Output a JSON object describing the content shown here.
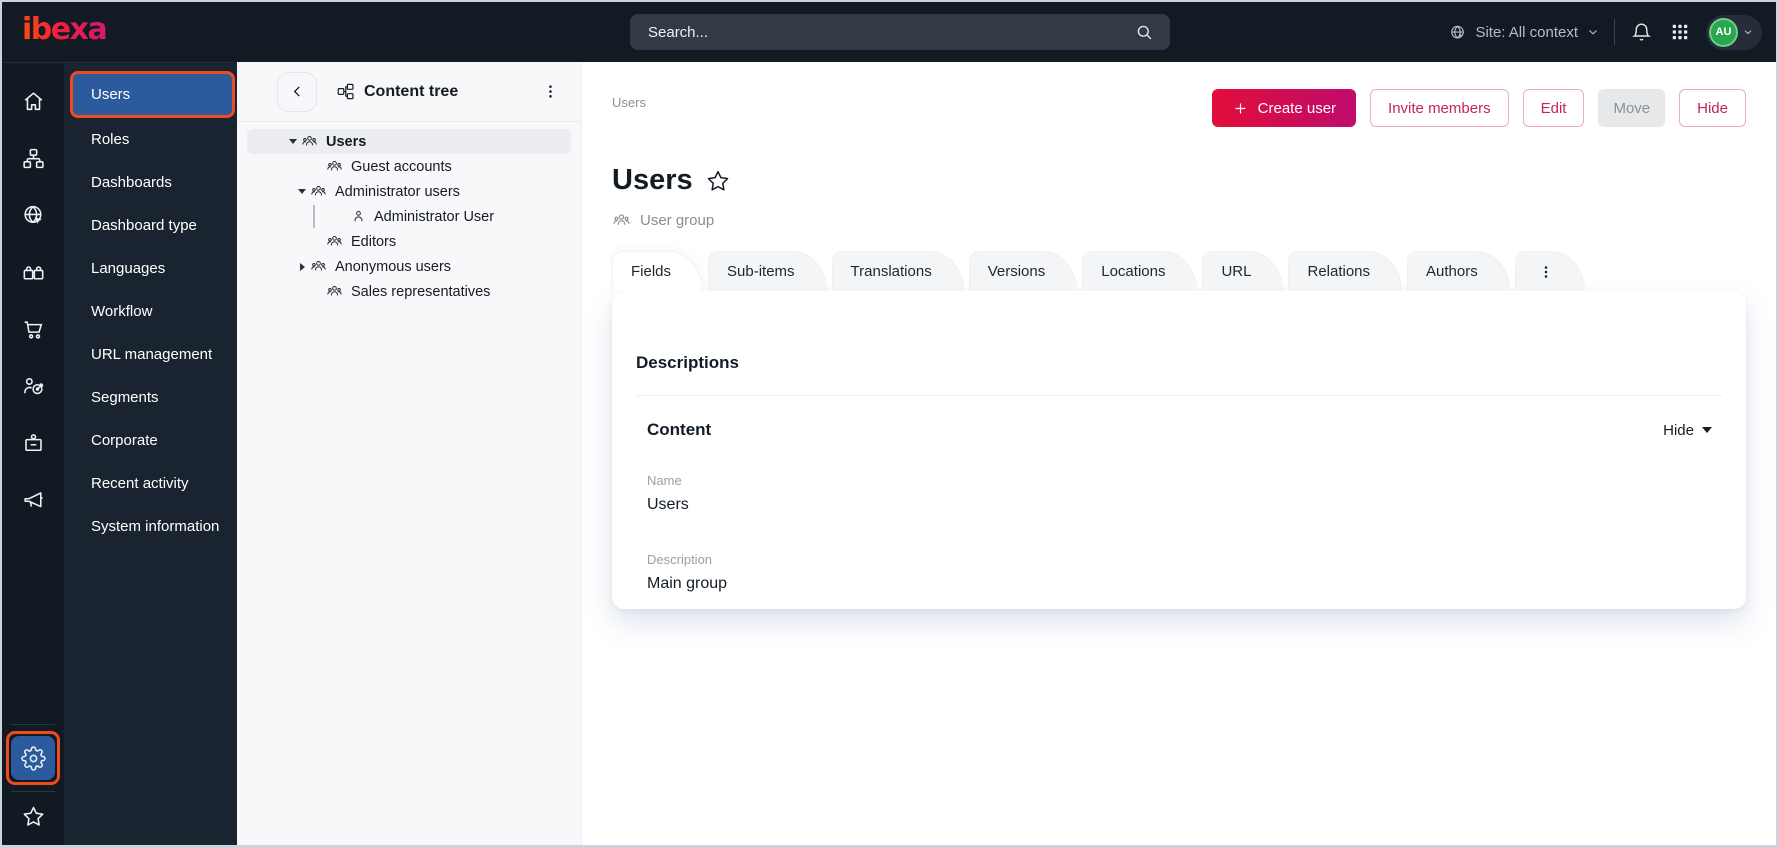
{
  "colors": {
    "topbar_bg": "#121a24",
    "rail_bg": "#111923",
    "sidebar_bg": "#1a2430",
    "selected_blue": "#2b5b9c",
    "focus_orange": "#f04a21",
    "primary_gradient_start": "#e20d3a",
    "primary_gradient_end": "#bf0c6d",
    "pink_text": "#c22461",
    "avatar_green": "#2aa64e",
    "panel_bg": "#f8f8fa"
  },
  "topbar": {
    "logo": "ibexa",
    "search": {
      "placeholder": "Search...",
      "icon": "search-icon"
    },
    "site_context": {
      "label": "Site: All context",
      "icon": "site-globe-icon"
    },
    "icons": [
      "bell-icon",
      "app-grid-icon"
    ],
    "user": {
      "initials": "AU"
    }
  },
  "rail": {
    "items": [
      {
        "icon": "home-icon"
      },
      {
        "icon": "content-structure-icon"
      },
      {
        "icon": "site-icon"
      },
      {
        "icon": "products-icon"
      },
      {
        "icon": "commerce-cart-icon"
      },
      {
        "icon": "customers-icon"
      },
      {
        "icon": "corporate-badge-icon"
      },
      {
        "icon": "marketing-megaphone-icon"
      }
    ],
    "bottom": [
      {
        "icon": "settings-gear-icon",
        "selected": true
      },
      {
        "icon": "bookmarks-star-icon"
      }
    ]
  },
  "sidebar": {
    "items": [
      {
        "label": "Users",
        "selected": true
      },
      {
        "label": "Roles"
      },
      {
        "label": "Dashboards"
      },
      {
        "label": "Dashboard type"
      },
      {
        "label": "Languages"
      },
      {
        "label": "Workflow"
      },
      {
        "label": "URL management"
      },
      {
        "label": "Segments"
      },
      {
        "label": "Corporate"
      },
      {
        "label": "Recent activity"
      },
      {
        "label": "System information"
      }
    ]
  },
  "content_tree": {
    "title": "Content tree",
    "nodes": [
      {
        "label": "Users",
        "level": 0,
        "state": "expanded",
        "icon": "user-group-icon",
        "selected": true
      },
      {
        "label": "Guest accounts",
        "level": 1,
        "icon": "user-group-icon"
      },
      {
        "label": "Administrator users",
        "level": 1,
        "state": "expanded",
        "icon": "user-group-icon"
      },
      {
        "label": "Administrator User",
        "level": 2,
        "icon": "user-icon"
      },
      {
        "label": "Editors",
        "level": 1,
        "icon": "user-group-icon"
      },
      {
        "label": "Anonymous users",
        "level": 1,
        "state": "collapsed",
        "icon": "user-group-icon"
      },
      {
        "label": "Sales representatives",
        "level": 1,
        "icon": "user-group-icon"
      }
    ]
  },
  "main": {
    "breadcrumb": "Users",
    "actions": {
      "create": "Create user",
      "invite": "Invite members",
      "edit": "Edit",
      "move": "Move",
      "hide": "Hide"
    },
    "title": "Users",
    "content_type": "User group",
    "tabs": [
      {
        "label": "Fields",
        "active": true
      },
      {
        "label": "Sub-items"
      },
      {
        "label": "Translations"
      },
      {
        "label": "Versions"
      },
      {
        "label": "Locations"
      },
      {
        "label": "URL"
      },
      {
        "label": "Relations"
      },
      {
        "label": "Authors"
      }
    ],
    "card": {
      "title": "Descriptions",
      "section": {
        "title": "Content",
        "toggle_label": "Hide"
      },
      "fields": [
        {
          "label": "Name",
          "value": "Users"
        },
        {
          "label": "Description",
          "value": "Main group"
        }
      ]
    }
  }
}
